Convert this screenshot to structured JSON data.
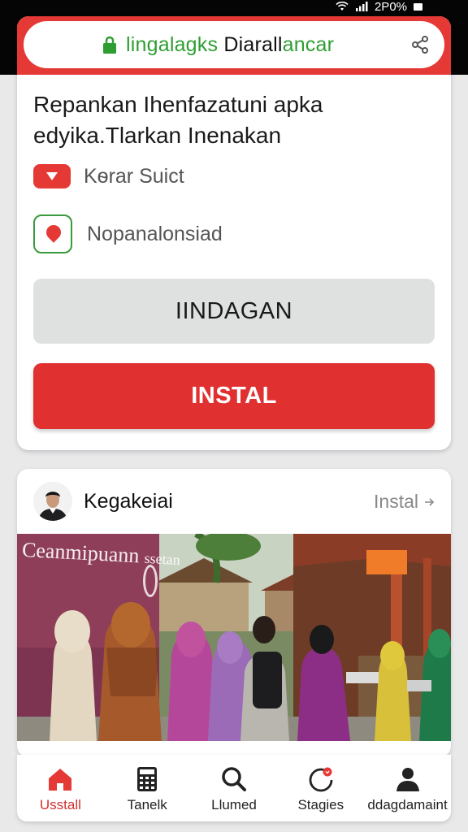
{
  "status_bar": {
    "battery_text": "2P0%"
  },
  "browser": {
    "url_part_green": "lingalagks",
    "url_part_dark": "Diarall",
    "url_part_green_end": "ancar"
  },
  "app_card": {
    "headline_line1": "Repankan Ihenfazatuni apka",
    "headline_line2": "edyika.Tlarkan Inenakan",
    "row_1_label": "Kѳrar Suict",
    "row_2_label": "Nopanalonsiad",
    "secondary_button": "IINDAGAN",
    "primary_button": "INSTAL"
  },
  "post": {
    "author": "Kegakeiai",
    "action_label": "Instal",
    "banner_text": "Ceanmipuann",
    "banner_subtext": "ssetan"
  },
  "bottom_nav": {
    "items": [
      {
        "label": "Usstall",
        "icon": "home-icon",
        "active": true
      },
      {
        "label": "Tanelk",
        "icon": "calculator-icon",
        "active": false
      },
      {
        "label": "Llumed",
        "icon": "search-icon",
        "active": false
      },
      {
        "label": "Stagies",
        "icon": "stories-icon",
        "active": false
      },
      {
        "label": "ddagdamaint",
        "icon": "person-icon",
        "active": false
      }
    ]
  },
  "colors": {
    "accent_red": "#e03030",
    "url_green": "#2e9e32",
    "background": "#e9e9ea"
  }
}
